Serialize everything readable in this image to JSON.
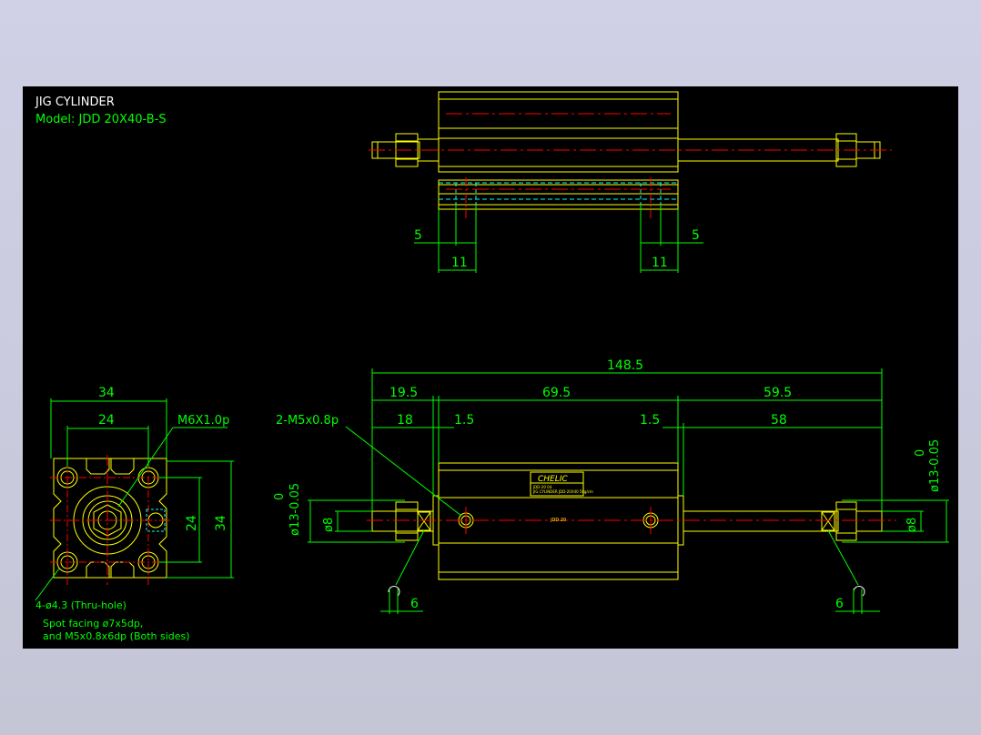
{
  "title": {
    "line1": "JIG CYLINDER",
    "line2": "Model: JDD 20X40-B-S"
  },
  "top_view_dims": {
    "left_5": "5",
    "left_11": "11",
    "right_5": "5",
    "right_11": "11"
  },
  "end_view_dims": {
    "width_34": "34",
    "width_24": "24",
    "height_24": "24",
    "height_34": "34",
    "thread": "M6X1.0p",
    "holes": "4-ø4.3 (Thru-hole)",
    "spot_line1": "Spot facing ø7x5dp,",
    "spot_line2": "and M5x0.8x6dp (Both sides)"
  },
  "side_view_dims": {
    "overall": "148.5",
    "left_19_5": "19.5",
    "mid_69_5": "69.5",
    "right_59_5": "59.5",
    "left_18": "18",
    "left_1_5": "1.5",
    "right_1_5": "1.5",
    "right_58": "58",
    "port": "2-M5x0.8p",
    "tol_zero_left": "0",
    "tol_dia13_left": "ø13-0.05",
    "dia8_left": "ø8",
    "tol_zero_right": "0",
    "tol_dia13_right": "ø13-0.05",
    "dia8_right": "ø8",
    "wrench_left": "6",
    "wrench_right": "6"
  },
  "label_plate": {
    "brand": "CHELIC",
    "line1": "JDD-20 04",
    "line2": "JIG CYLINDER JDD-20X40 5kg/cm",
    "body_text": "JDD 20"
  },
  "colors": {
    "background": "#000000",
    "outline": "#ffff00",
    "dimension": "#00ff00",
    "centerline": "#ff0000",
    "hidden": "#00ffff",
    "text": "#ffffff"
  }
}
